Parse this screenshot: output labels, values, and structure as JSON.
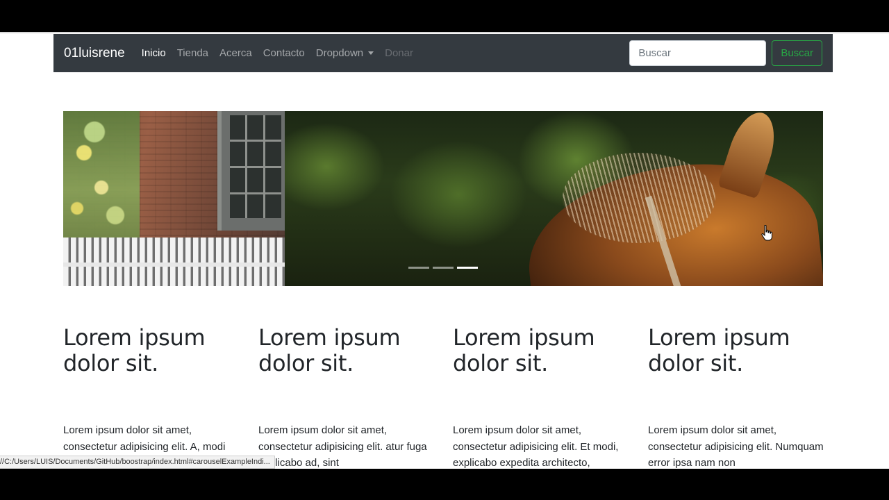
{
  "navbar": {
    "brand": "01luisrene",
    "links": [
      {
        "label": "Inicio",
        "state": "active"
      },
      {
        "label": "Tienda",
        "state": "normal"
      },
      {
        "label": "Acerca",
        "state": "normal"
      },
      {
        "label": "Contacto",
        "state": "normal"
      },
      {
        "label": "Dropdown",
        "state": "dropdown"
      },
      {
        "label": "Donar",
        "state": "disabled"
      }
    ],
    "search": {
      "placeholder": "Buscar",
      "value": ""
    },
    "search_button": "Buscar"
  },
  "carousel": {
    "indicator_count": 3,
    "active_index": 2,
    "previous_slide_image": "brick-house-window-fence-photo",
    "current_slide_image": "horse-head-photo"
  },
  "columns": [
    {
      "title": "Lorem ipsum dolor sit.",
      "text": "Lorem ipsum dolor sit amet, consectetur adipisicing elit. A, modi"
    },
    {
      "title": "Lorem ipsum dolor sit.",
      "text": "Lorem ipsum dolor sit amet, consectetur adipisicing elit. atur fuga explicabo ad, sint"
    },
    {
      "title": "Lorem ipsum dolor sit.",
      "text": "Lorem ipsum dolor sit amet, consectetur adipisicing elit. Et modi, explicabo expedita architecto,"
    },
    {
      "title": "Lorem ipsum dolor sit.",
      "text": "Lorem ipsum dolor sit amet, consectetur adipisicing elit. Numquam error ipsa nam non"
    }
  ],
  "status_bar": {
    "url": "//C:/Users/LUIS/Documents/GitHub/boostrap/index.html#carouselExampleIndi..."
  },
  "colors": {
    "navbar_bg": "#343a40",
    "success": "#28a745",
    "text": "#212529"
  }
}
